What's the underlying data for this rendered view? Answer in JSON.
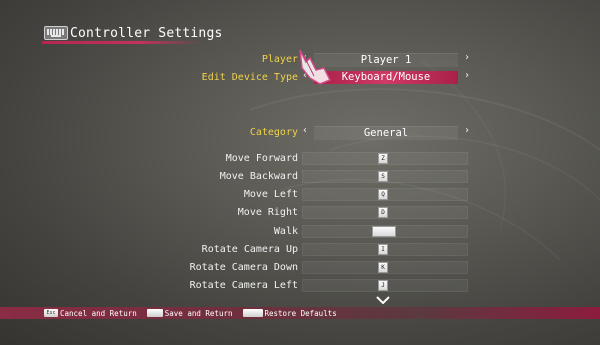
{
  "header": {
    "title": "Controller Settings",
    "icon": "keyboard-icon"
  },
  "selectors": [
    {
      "label": "Player",
      "value": "Player 1",
      "highlighted": false
    },
    {
      "label": "Edit Device Type",
      "value": "Keyboard/Mouse",
      "highlighted": true
    },
    {
      "label": "Category",
      "value": "General",
      "highlighted": false
    }
  ],
  "bindings": [
    {
      "action": "Move Forward",
      "key": "Z"
    },
    {
      "action": "Move Backward",
      "key": "S"
    },
    {
      "action": "Move Left",
      "key": "Q"
    },
    {
      "action": "Move Right",
      "key": "D"
    },
    {
      "action": "Walk",
      "key": ""
    },
    {
      "action": "Rotate Camera Up",
      "key": "I"
    },
    {
      "action": "Rotate Camera Down",
      "key": "K"
    },
    {
      "action": "Rotate Camera Left",
      "key": "J"
    }
  ],
  "footer": {
    "cancel_key": "Esc",
    "cancel_label": "Cancel and Return",
    "save_key": "",
    "save_label": "Save and Return",
    "restore_key": "",
    "restore_label": "Restore Defaults"
  },
  "colors": {
    "accent": "#c5325b",
    "label_yellow": "#f0d24a"
  }
}
